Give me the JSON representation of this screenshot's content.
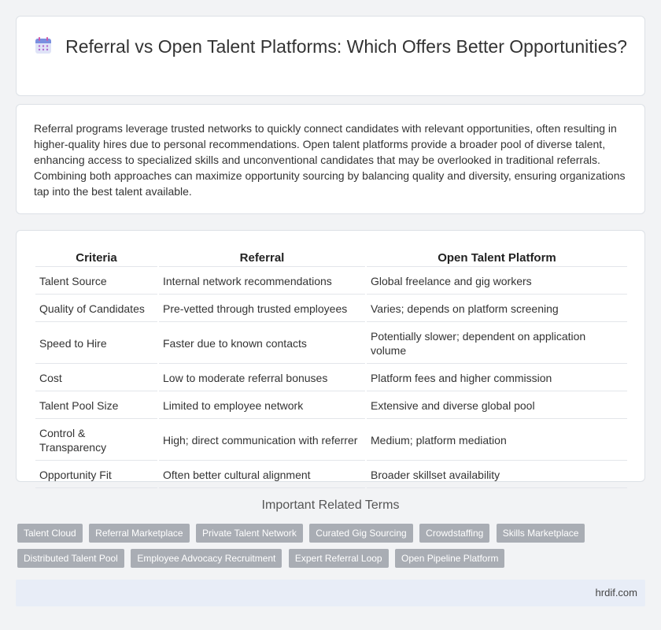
{
  "header": {
    "title": "Referral vs Open Talent Platforms: Which Offers Better Opportunities?",
    "icon": "calendar-icon"
  },
  "intro": {
    "text": "Referral programs leverage trusted networks to quickly connect candidates with relevant opportunities, often resulting in higher-quality hires due to personal recommendations. Open talent platforms provide a broader pool of diverse talent, enhancing access to specialized skills and unconventional candidates that may be overlooked in traditional referrals. Combining both approaches can maximize opportunity sourcing by balancing quality and diversity, ensuring organizations tap into the best talent available."
  },
  "table": {
    "headers": [
      "Criteria",
      "Referral",
      "Open Talent Platform"
    ],
    "rows": [
      [
        "Talent Source",
        "Internal network recommendations",
        "Global freelance and gig workers"
      ],
      [
        "Quality of Candidates",
        "Pre-vetted through trusted employees",
        "Varies; depends on platform screening"
      ],
      [
        "Speed to Hire",
        "Faster due to known contacts",
        "Potentially slower; dependent on application volume"
      ],
      [
        "Cost",
        "Low to moderate referral bonuses",
        "Platform fees and higher commission"
      ],
      [
        "Talent Pool Size",
        "Limited to employee network",
        "Extensive and diverse global pool"
      ],
      [
        "Control & Transparency",
        "High; direct communication with referrer",
        "Medium; platform mediation"
      ],
      [
        "Opportunity Fit",
        "Often better cultural alignment",
        "Broader skillset availability"
      ]
    ]
  },
  "related": {
    "heading": "Important Related Terms",
    "tags": [
      "Talent Cloud",
      "Referral Marketplace",
      "Private Talent Network",
      "Curated Gig Sourcing",
      "Crowdstaffing",
      "Skills Marketplace",
      "Distributed Talent Pool",
      "Employee Advocacy Recruitment",
      "Expert Referral Loop",
      "Open Pipeline Platform"
    ]
  },
  "footer": {
    "site": "hrdif.com"
  },
  "colors": {
    "tag_bg": "#a9adb4",
    "footer_bg": "#e8edf7",
    "page_bg": "#f2f3f5"
  }
}
